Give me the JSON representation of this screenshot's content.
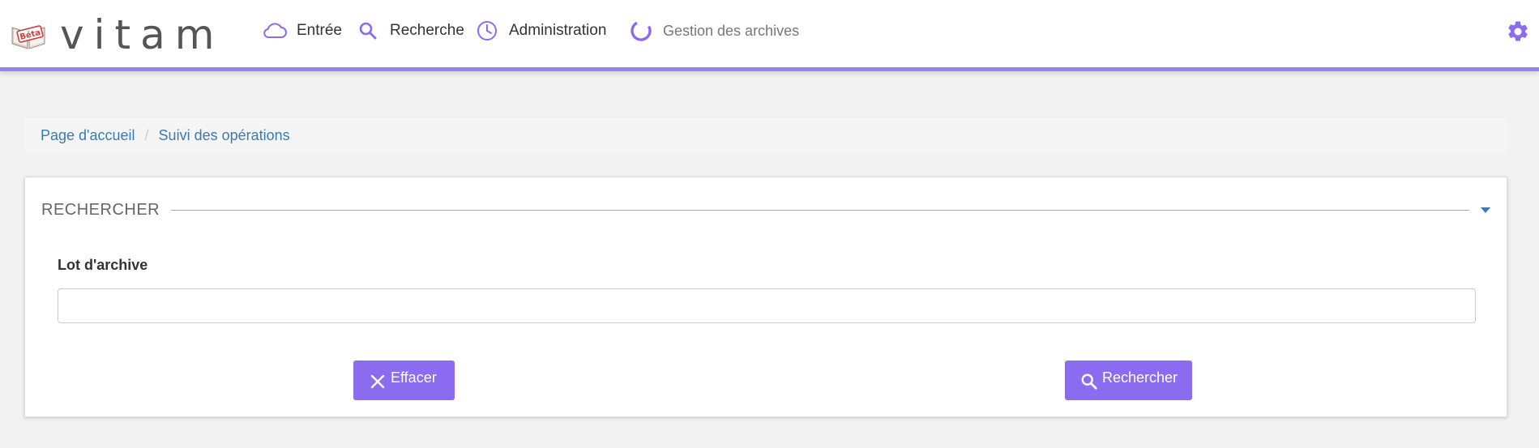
{
  "app": {
    "logo_text": "vitam",
    "badge_text": "Béta"
  },
  "nav": {
    "entree": "Entrée",
    "recherche": "Recherche",
    "administration": "Administration",
    "gestion": "Gestion des archives"
  },
  "breadcrumb": {
    "home": "Page d'accueil",
    "separator": "/",
    "current": "Suivi des opérations"
  },
  "search_panel": {
    "title": "RECHERCHER",
    "field_label": "Lot d'archive",
    "field_value": "",
    "clear_label": "Effacer",
    "search_label": "Rechercher"
  },
  "colors": {
    "accent": "#8b6cf0",
    "nav_icon": "#8b6cf0",
    "link": "#3a7ab5",
    "header_border": "#9a82ea"
  },
  "icons": {
    "entree": "cloud-icon",
    "recherche": "search-icon",
    "administration": "clock-icon",
    "gestion": "loading-circle-icon",
    "settings": "gear-icon",
    "clear": "close-icon",
    "search_button": "search-icon"
  }
}
